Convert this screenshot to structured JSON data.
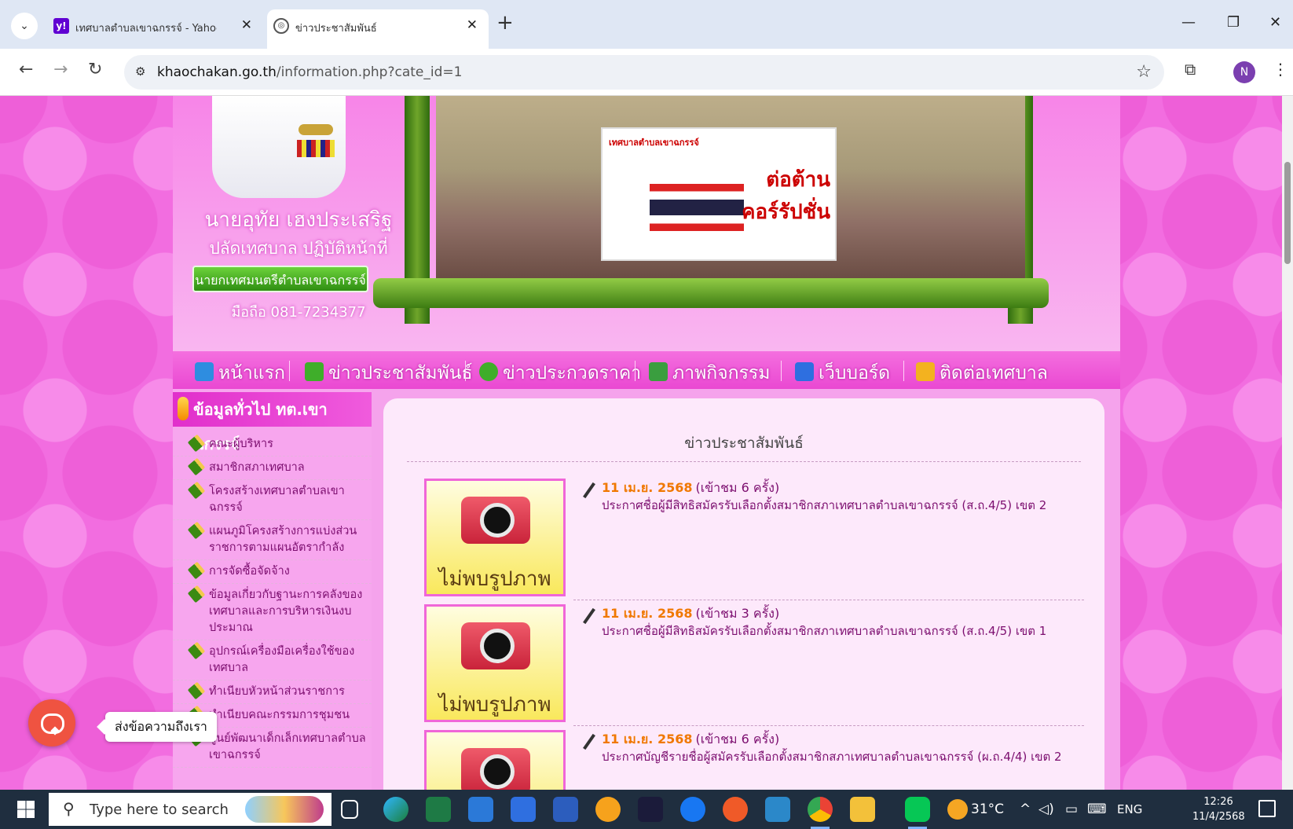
{
  "browser": {
    "tabs": [
      {
        "favicon": "y!",
        "title": "เทศบาลตำบลเขาฉกรรจ์ - Yahoo ร"
      },
      {
        "favicon": "globe-icon",
        "title": "ข่าวประชาสัมพันธ์"
      }
    ],
    "url_host": "khaochakan.go.th",
    "url_path": "/information.php?cate_id=1",
    "profile_initial": "N"
  },
  "header": {
    "officer_name": "นายอุทัย เฮงประเสริฐ",
    "officer_position": "ปลัดเทศบาล ปฏิบัติหน้าที่",
    "officer_badge": "นายกเทศมนตรีตำบลเขาฉกรรจ์",
    "officer_phone": "มือถือ 081-7234377",
    "banner_title": "เทศบาลตำบลเขาฉกรรจ์",
    "banner_big": "ต่อต้าน คอร์รัปชั่น"
  },
  "menu": [
    {
      "label": "หน้าแรก",
      "icon": "home-icon",
      "color": "#2e8de0"
    },
    {
      "label": "ข่าวประชาสัมพันธ์",
      "icon": "pencil-icon",
      "color": "#3fae2a"
    },
    {
      "label": "ข่าวประกวดราคา",
      "icon": "money-bag-icon",
      "color": "#3fae2a"
    },
    {
      "label": "ภาพกิจกรรม",
      "icon": "picture-icon",
      "color": "#3a9e3f"
    },
    {
      "label": "เว็บบอร์ด",
      "icon": "board-icon",
      "color": "#2e6fe0"
    },
    {
      "label": "ติดต่อเทศบาล",
      "icon": "mail-icon",
      "color": "#f3b21f"
    }
  ],
  "sidebar": {
    "header": "ข้อมูลทั่วไป ทต.เขาฉกรรจ์",
    "items": [
      "คณะผู้บริหาร",
      "สมาชิกสภาเทศบาล",
      "โครงสร้างเทศบาลตำบลเขาฉกรรจ์",
      "แผนภูมิโครงสร้างการแบ่งส่วนราชการตามแผนอัตรากำลัง",
      "การจัดซื้อจัดจ้าง",
      "ข้อมูลเกี่ยวกับฐานะการคลังของเทศบาลและการบริหารเงินงบประมาณ",
      "อุปกรณ์เครื่องมือเครื่องใช้ของเทศบาล",
      "ทำเนียบหัวหน้าส่วนราชการ",
      "ทำเนียบคณะกรรมการชุมชน",
      "ศูนย์พัฒนาเด็กเล็กเทศบาลตำบลเขาฉกรรจ์"
    ]
  },
  "content": {
    "title": "ข่าวประชาสัมพันธ์",
    "no_photo": "ไม่พบรูปภาพ",
    "news": [
      {
        "date": "11 เม.ย. 2568",
        "views": "(เข้าชม 6 ครั้ง)",
        "text": "ประกาศชื่อผู้มีสิทธิสมัครรับเลือกตั้งสมาชิกสภาเทศบาลตำบลเขาฉกรรจ์ (ส.ถ.4/5) เขต 2"
      },
      {
        "date": "11 เม.ย. 2568",
        "views": "(เข้าชม 3 ครั้ง)",
        "text": "ประกาศชื่อผู้มีสิทธิสมัครรับเลือกตั้งสมาชิกสภาเทศบาลตำบลเขาฉกรรจ์ (ส.ถ.4/5) เขต 1"
      },
      {
        "date": "11 เม.ย. 2568",
        "views": "(เข้าชม 6 ครั้ง)",
        "text": "ประกาศบัญชีรายชื่อผู้สมัครรับเลือกตั้งสมาชิกสภาเทศบาลตำบลเขาฉกรรจ์ (ผ.ถ.4/4) เขต 2"
      }
    ]
  },
  "chat": {
    "tooltip": "ส่งข้อความถึงเรา"
  },
  "taskbar": {
    "search_placeholder": "Type here to search",
    "temperature": "31°C",
    "language": "ENG",
    "time": "12:26",
    "date": "11/4/2568"
  }
}
